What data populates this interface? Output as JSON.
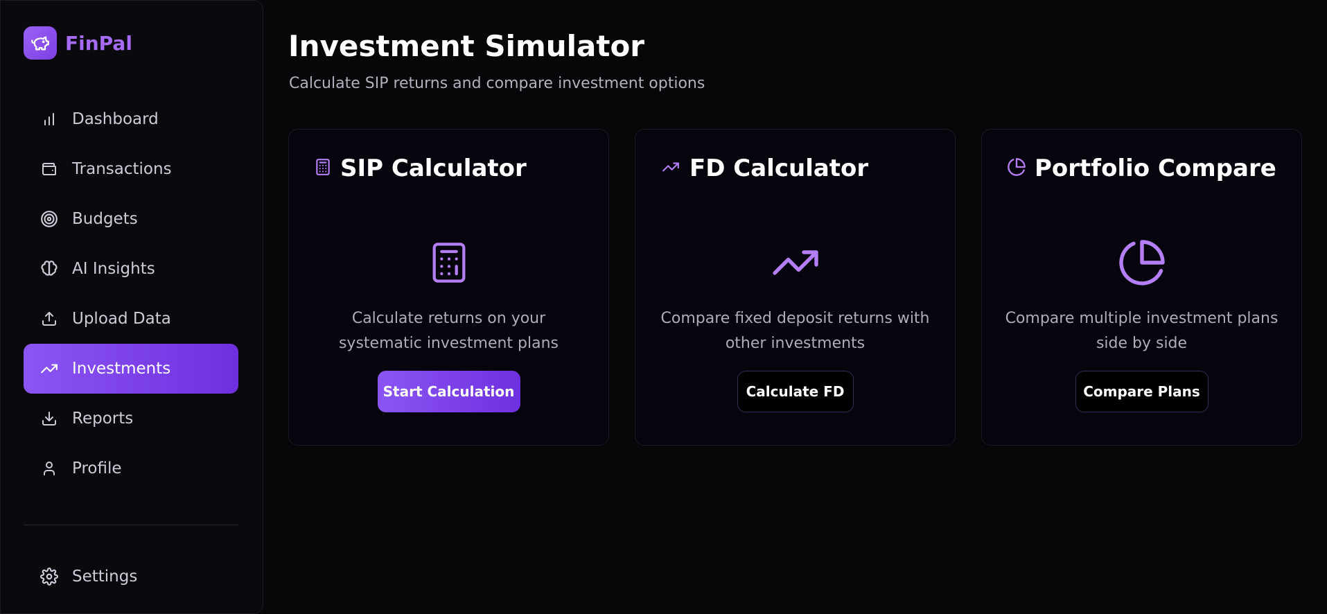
{
  "brand": {
    "name": "FinPal",
    "logo_icon": "piggy-bank-icon"
  },
  "sidebar": {
    "items": [
      {
        "label": "Dashboard",
        "icon": "bar-chart-icon",
        "active": false
      },
      {
        "label": "Transactions",
        "icon": "wallet-icon",
        "active": false
      },
      {
        "label": "Budgets",
        "icon": "target-icon",
        "active": false
      },
      {
        "label": "AI Insights",
        "icon": "brain-icon",
        "active": false
      },
      {
        "label": "Upload Data",
        "icon": "upload-icon",
        "active": false
      },
      {
        "label": "Investments",
        "icon": "trending-up-icon",
        "active": true
      },
      {
        "label": "Reports",
        "icon": "download-icon",
        "active": false
      },
      {
        "label": "Profile",
        "icon": "user-icon",
        "active": false
      }
    ],
    "settings": {
      "label": "Settings",
      "icon": "gear-icon"
    }
  },
  "page": {
    "title": "Investment Simulator",
    "subtitle": "Calculate SIP returns and compare investment options"
  },
  "cards": [
    {
      "title": "SIP Calculator",
      "icon": "calculator-icon",
      "description": "Calculate returns on your systematic investment plans",
      "button": "Start Calculation"
    },
    {
      "title": "FD Calculator",
      "icon": "trending-up-icon",
      "description": "Compare fixed deposit returns with other investments",
      "button": "Calculate FD"
    },
    {
      "title": "Portfolio Compare",
      "icon": "pie-chart-icon",
      "description": "Compare multiple investment plans side by side",
      "button": "Compare Plans"
    }
  ],
  "colors": {
    "accent": "#8b55f3",
    "accent_dark": "#6e30df",
    "icon_purple": "#b47ef5",
    "background": "#070609",
    "card": "#06050d"
  }
}
